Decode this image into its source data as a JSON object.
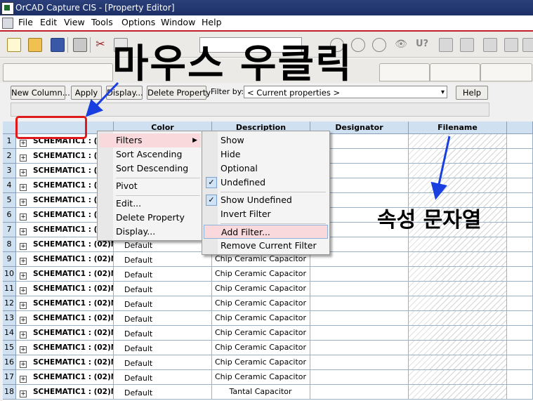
{
  "window": {
    "title": "OrCAD Capture CIS - [Property Editor]"
  },
  "menubar": {
    "items": [
      "File",
      "Edit",
      "View",
      "Tools",
      "Options",
      "Window",
      "Help"
    ]
  },
  "property_toolbar": {
    "new_column": "New Column...",
    "apply": "Apply",
    "display": "Display...",
    "delete_property": "Delete Property",
    "filter_label": "Filter by:",
    "filter_value": "< Current properties >",
    "help": "Help"
  },
  "grid": {
    "columns": [
      "",
      "Color",
      "Description",
      "Designator",
      "Filename"
    ],
    "rows": [
      {
        "num": "1",
        "name": "SCHEMATIC1 : (0",
        "color": "",
        "desc": ""
      },
      {
        "num": "2",
        "name": "SCHEMATIC1 : (0",
        "color": "",
        "desc": ""
      },
      {
        "num": "3",
        "name": "SCHEMATIC1 : (0",
        "color": "",
        "desc": ""
      },
      {
        "num": "4",
        "name": "SCHEMATIC1 : (0",
        "color": "",
        "desc": ""
      },
      {
        "num": "5",
        "name": "SCHEMATIC1 : (0",
        "color": "",
        "desc": ""
      },
      {
        "num": "6",
        "name": "SCHEMATIC1 : (0",
        "color": "",
        "desc": ""
      },
      {
        "num": "7",
        "name": "SCHEMATIC1 : (0",
        "color": "",
        "desc": ""
      },
      {
        "num": "8",
        "name": "SCHEMATIC1 : (02)M",
        "color": "Default",
        "desc": ""
      },
      {
        "num": "9",
        "name": "SCHEMATIC1 : (02)M",
        "color": "Default",
        "desc": "Chip Ceramic Capacitor"
      },
      {
        "num": "10",
        "name": "SCHEMATIC1 : (02)M",
        "color": "Default",
        "desc": "Chip Ceramic Capacitor"
      },
      {
        "num": "11",
        "name": "SCHEMATIC1 : (02)M",
        "color": "Default",
        "desc": "Chip Ceramic Capacitor"
      },
      {
        "num": "12",
        "name": "SCHEMATIC1 : (02)M",
        "color": "Default",
        "desc": "Chip Ceramic Capacitor"
      },
      {
        "num": "13",
        "name": "SCHEMATIC1 : (02)M",
        "color": "Default",
        "desc": "Chip Ceramic Capacitor"
      },
      {
        "num": "14",
        "name": "SCHEMATIC1 : (02)M",
        "color": "Default",
        "desc": "Chip Ceramic Capacitor"
      },
      {
        "num": "15",
        "name": "SCHEMATIC1 : (02)M",
        "color": "Default",
        "desc": "Chip Ceramic Capacitor"
      },
      {
        "num": "16",
        "name": "SCHEMATIC1 : (02)M",
        "color": "Default",
        "desc": "Chip Ceramic Capacitor"
      },
      {
        "num": "17",
        "name": "SCHEMATIC1 : (02)M",
        "color": "Default",
        "desc": "Chip Ceramic Capacitor"
      },
      {
        "num": "18",
        "name": "SCHEMATIC1 : (02)M",
        "color": "Default",
        "desc": "Tantal Capacitor"
      }
    ]
  },
  "context_menu": {
    "items": [
      "Filters",
      "Sort Ascending",
      "Sort Descending",
      "Pivot",
      "Edit...",
      "Delete Property",
      "Display..."
    ]
  },
  "filters_submenu": {
    "items": [
      "Show",
      "Hide",
      "Optional",
      "Undefined",
      "Show Undefined",
      "Invert Filter",
      "Add Filter...",
      "Remove Current Filter"
    ]
  },
  "annotations": {
    "title": "마우스 우클릭",
    "filename_note": "속성 문자열",
    "highlight_color": "#e01a1a"
  },
  "colors": {
    "header_bg": "#cfe0f0",
    "menu_highlight": "#f9d9dc",
    "title_bar": "#1c2f66"
  }
}
